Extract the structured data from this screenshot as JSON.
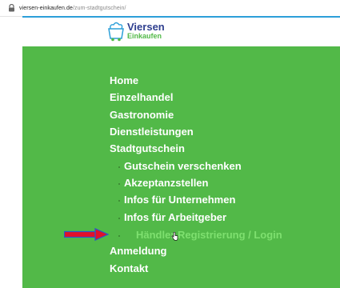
{
  "browser": {
    "url_host": "viersen-einkaufen.de",
    "url_path": "/zum-stadtgutschein/",
    "lock_icon": "lock-icon"
  },
  "logo": {
    "line1": "Viersen",
    "line2": "Einkaufen",
    "icon": "shopping-bag-icon"
  },
  "menu": {
    "items": [
      {
        "label": "Home"
      },
      {
        "label": "Einzelhandel"
      },
      {
        "label": "Gastronomie"
      },
      {
        "label": "Dienstleistungen"
      },
      {
        "label": "Stadtgutschein"
      }
    ],
    "submenu": [
      {
        "label": "Gutschein verschenken"
      },
      {
        "label": "Akzeptanzstellen"
      },
      {
        "label": "Infos für Unternehmen"
      },
      {
        "label": "Infos für Arbeitgeber"
      },
      {
        "label": "Händler Registrierung / Login"
      }
    ],
    "footer_items": [
      {
        "label": "Anmeldung"
      },
      {
        "label": "Kontakt"
      }
    ]
  },
  "colors": {
    "menu_background": "#52b948",
    "active_link": "#7ee06f",
    "logo_blue": "#2f3f8f",
    "logo_green": "#52b948",
    "accent_bar": "#2c9fd9",
    "annotation_arrow": "#e0102a"
  },
  "annotation": {
    "icon": "red-arrow-annotation",
    "cursor": "hand-pointer-cursor-icon"
  }
}
